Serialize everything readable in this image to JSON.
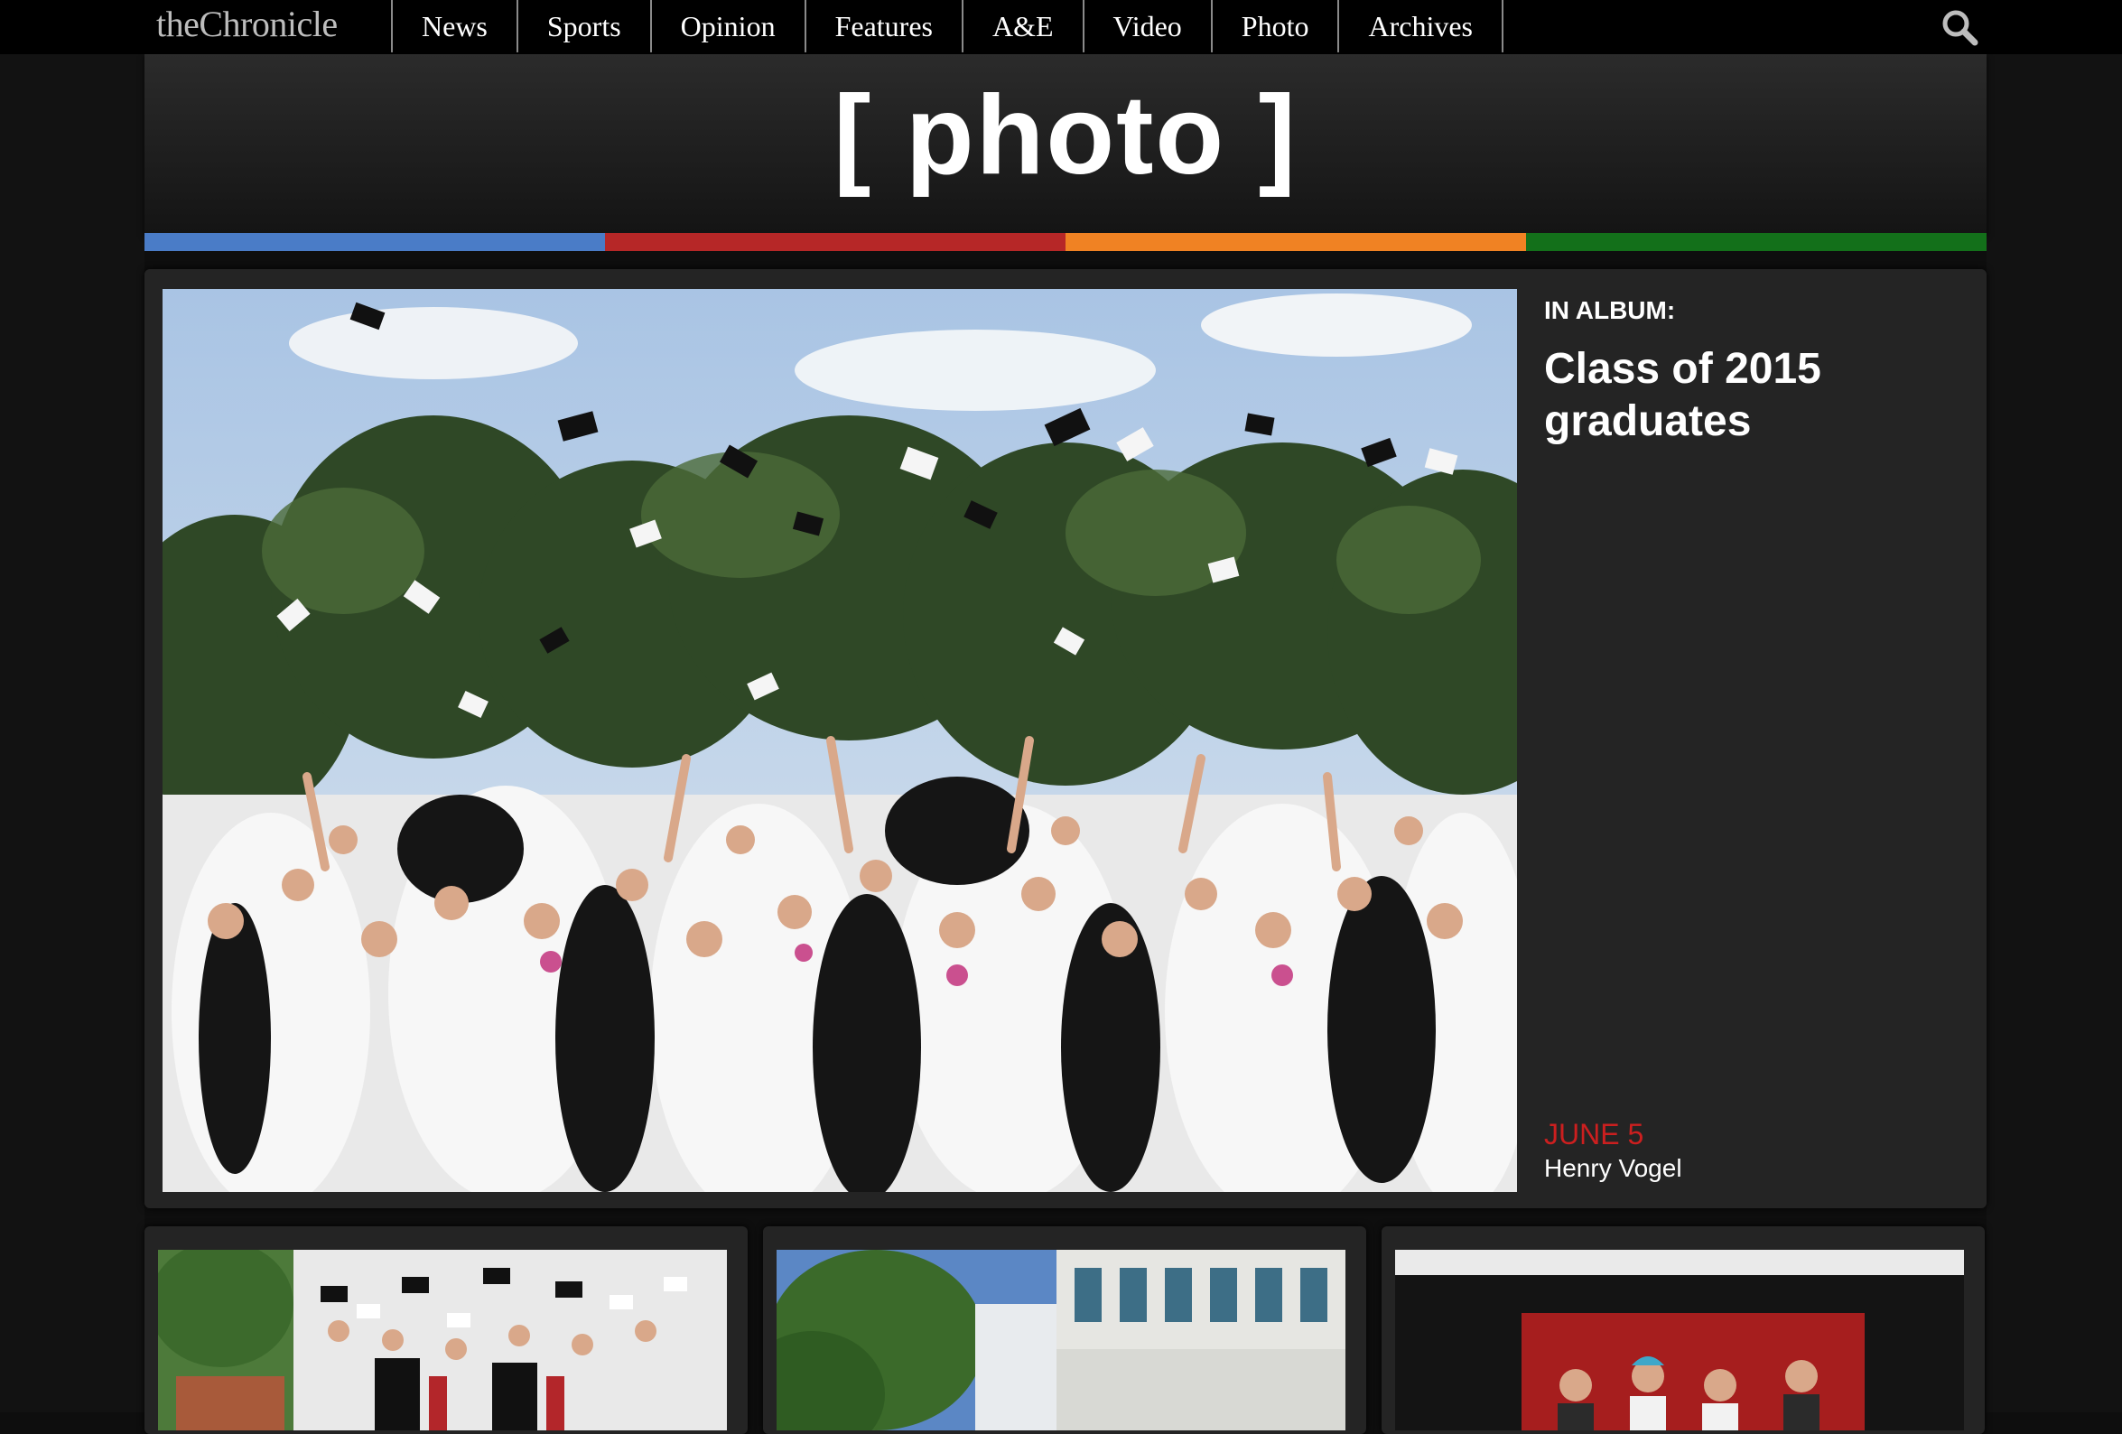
{
  "nav": {
    "logo": "theChronicle",
    "items": [
      {
        "label": "News"
      },
      {
        "label": "Sports"
      },
      {
        "label": "Opinion"
      },
      {
        "label": "Features"
      },
      {
        "label": "A&E"
      },
      {
        "label": "Video"
      },
      {
        "label": "Photo"
      },
      {
        "label": "Archives"
      }
    ],
    "search_icon": "search-icon"
  },
  "banner": {
    "title": "[ photo ]",
    "stripe_colors": [
      "#4a7cc7",
      "#b62727",
      "#f08223",
      "#13701a"
    ]
  },
  "featured": {
    "album_label": "IN ALBUM:",
    "album_title": "Class of 2015 graduates",
    "date": "JUNE 5",
    "author": "Henry Vogel"
  },
  "colors": {
    "accent_date": "#cc1f1f",
    "background": "#0e0e0e",
    "card": "#242424"
  },
  "thumbnails": [
    {
      "name": "graduates-thumbnail"
    },
    {
      "name": "campus-building-thumbnail"
    },
    {
      "name": "group-stage-thumbnail"
    }
  ]
}
